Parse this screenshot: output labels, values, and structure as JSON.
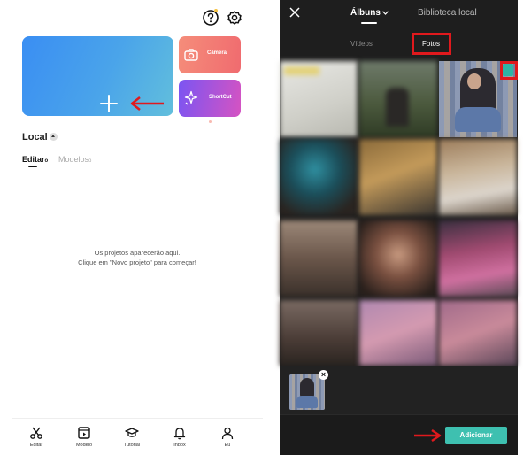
{
  "left": {
    "card_new_project": "Novo projeto",
    "card_camera": "Câmera",
    "card_shortcut": "ShortCut",
    "section_title": "Local",
    "tabs": [
      {
        "label": "Editar",
        "suffix": "o",
        "active": true
      },
      {
        "label": "Modelos",
        "suffix": "o",
        "active": false
      }
    ],
    "empty_line1": "Os projetos aparecerão aqui.",
    "empty_line2": "Clique em \"Novo projeto\" para começar!",
    "nav": [
      {
        "label": "Editar",
        "icon": "scissors-icon"
      },
      {
        "label": "Modelo",
        "icon": "template-icon"
      },
      {
        "label": "Tutorial",
        "icon": "graduation-cap-icon"
      },
      {
        "label": "Inbox",
        "icon": "bell-icon"
      },
      {
        "label": "Eu",
        "icon": "person-icon"
      }
    ]
  },
  "right": {
    "tab_albums": "Álbuns",
    "tab_library": "Biblioteca local",
    "subtab_videos": "Vídeos",
    "subtab_photos": "Fotos",
    "add_button": "Adicionar",
    "selected_count_badge": "1",
    "annotation_color": "#e0191d",
    "accent_color": "#3ec0b0"
  }
}
